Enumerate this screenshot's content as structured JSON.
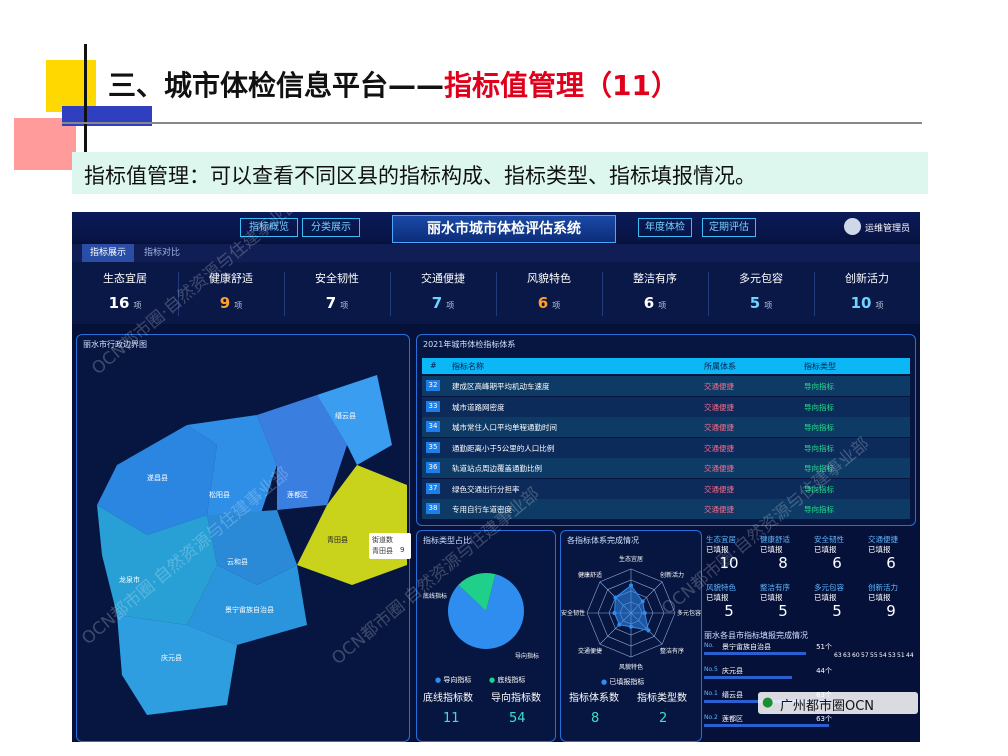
{
  "slide": {
    "title_prefix": "三、城市体检信息平台——",
    "title_highlight": "指标值管理（11）",
    "subtitle": "指标值管理：可以查看不同区县的指标构成、指标类型、指标填报情况。"
  },
  "dashboard": {
    "system_title": "丽水市城市体检评估系统",
    "top_buttons": [
      "指标概览",
      "分类展示",
      "年度体检",
      "定期评估"
    ],
    "user": "运维管理员",
    "tabs": [
      "指标展示",
      "指标对比"
    ],
    "categories": [
      {
        "name": "生态宜居",
        "value": "16",
        "unit": "项",
        "color": "#ffffff"
      },
      {
        "name": "健康舒适",
        "value": "9",
        "unit": "项",
        "color": "#ff9f2e"
      },
      {
        "name": "安全韧性",
        "value": "7",
        "unit": "项",
        "color": "#ffffff"
      },
      {
        "name": "交通便捷",
        "value": "7",
        "unit": "项",
        "color": "#6fd3ff"
      },
      {
        "name": "风貌特色",
        "value": "6",
        "unit": "项",
        "color": "#ff9f2e"
      },
      {
        "name": "整洁有序",
        "value": "6",
        "unit": "项",
        "color": "#ffffff"
      },
      {
        "name": "多元包容",
        "value": "5",
        "unit": "项",
        "color": "#6fd3ff"
      },
      {
        "name": "创新活力",
        "value": "10",
        "unit": "项",
        "color": "#6fd3ff"
      }
    ],
    "map": {
      "title": "丽水市行政边界图",
      "counties": [
        "遂昌县",
        "松阳县",
        "莲都区",
        "缙云县",
        "青田县",
        "云和县",
        "龙泉市",
        "景宁畲族自治县",
        "庆元县"
      ],
      "tooltip_title": "街道数",
      "tooltip_name": "青田县",
      "tooltip_value": "9"
    },
    "indicator_table": {
      "title": "2021年城市体检指标体系",
      "headers": [
        "#",
        "指标名称",
        "所属体系",
        "指标类型"
      ],
      "rows": [
        {
          "id": "32",
          "name": "建成区高峰期平均机动车速度",
          "system": "交通便捷",
          "type": "导向指标"
        },
        {
          "id": "33",
          "name": "城市道路网密度",
          "system": "交通便捷",
          "type": "导向指标"
        },
        {
          "id": "34",
          "name": "城市常住人口平均单程通勤时间",
          "system": "交通便捷",
          "type": "导向指标"
        },
        {
          "id": "35",
          "name": "通勤距离小于5公里的人口比例",
          "system": "交通便捷",
          "type": "导向指标"
        },
        {
          "id": "36",
          "name": "轨道站点周边覆盖通勤比例",
          "system": "交通便捷",
          "type": "导向指标"
        },
        {
          "id": "37",
          "name": "绿色交通出行分担率",
          "system": "交通便捷",
          "type": "导向指标"
        },
        {
          "id": "38",
          "name": "专用自行车道密度",
          "system": "交通便捷",
          "type": "导向指标"
        }
      ]
    },
    "type_panel": {
      "title": "指标类型占比",
      "legend": [
        "导向指标",
        "底线指标"
      ],
      "slice_labels": [
        "底线指标",
        "导向指标"
      ],
      "stats": [
        {
          "label": "底线指标数",
          "value": "11"
        },
        {
          "label": "导向指标数",
          "value": "54"
        }
      ],
      "chart_data": {
        "type": "pie",
        "categories": [
          "导向指标",
          "底线指标"
        ],
        "values": [
          54,
          11
        ],
        "colors": [
          "#2f8df0",
          "#1fd08a"
        ]
      }
    },
    "radar_panel": {
      "title": "各指标体系完成情况",
      "axes": [
        "生态宜居",
        "创新活力",
        "多元包容",
        "整洁有序",
        "风貌特色",
        "交通便捷",
        "安全韧性",
        "健康舒适"
      ],
      "legend": "已填报指标",
      "stats": [
        {
          "label": "指标体系数",
          "value": "8"
        },
        {
          "label": "指标类型数",
          "value": "2"
        }
      ],
      "chart_data": {
        "type": "radar",
        "categories": [
          "生态宜居",
          "创新活力",
          "多元包容",
          "整洁有序",
          "风貌特色",
          "交通便捷",
          "安全韧性",
          "健康舒适"
        ],
        "values": [
          10,
          6,
          5,
          9,
          5,
          6,
          6,
          8
        ]
      }
    },
    "fill_stats": [
      {
        "name": "生态宜居",
        "sub": "已填报",
        "value": "10"
      },
      {
        "name": "健康舒适",
        "sub": "已填报",
        "value": "8"
      },
      {
        "name": "安全韧性",
        "sub": "已填报",
        "value": "6"
      },
      {
        "name": "交通便捷",
        "sub": "已填报",
        "value": "6"
      },
      {
        "name": "风貌特色",
        "sub": "已填报",
        "value": "5"
      },
      {
        "name": "整洁有序",
        "sub": "已填报",
        "value": "5"
      },
      {
        "name": "多元包容",
        "sub": "已填报",
        "value": "5"
      },
      {
        "name": "创新活力",
        "sub": "已填报",
        "value": "9"
      }
    ],
    "ranking": {
      "title": "丽水各县市指标填报完成情况",
      "rows": [
        {
          "no": "No.",
          "name": "景宁畲族自治县",
          "value": "51个",
          "ratio": 0.8
        },
        {
          "no": "No.5",
          "name": "庆元县",
          "value": "44个",
          "ratio": 0.69
        },
        {
          "no": "No.1",
          "name": "缙云县",
          "value": "63个",
          "ratio": 0.98
        },
        {
          "no": "No.2",
          "name": "莲都区",
          "value": "63个",
          "ratio": 0.98
        }
      ],
      "bar_values": [
        "63",
        "63",
        "60",
        "57",
        "55",
        "54",
        "53",
        "51",
        "44"
      ]
    }
  },
  "watermarks": {
    "text": "OCN都市圈·自然资源与住建事业部",
    "badge": "广州都市圈OCN"
  }
}
